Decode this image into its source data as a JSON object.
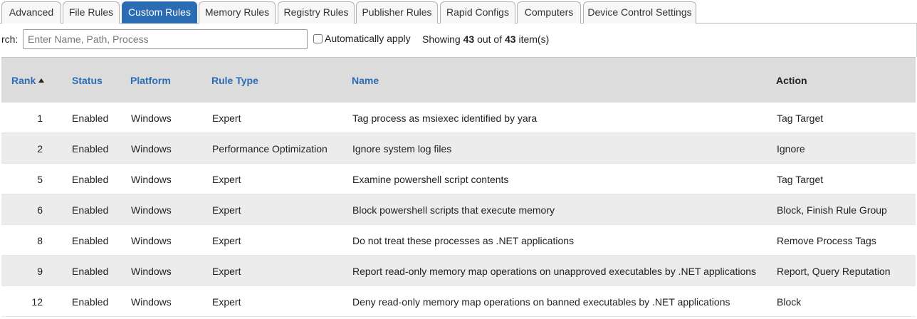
{
  "tabs": [
    {
      "label": "Advanced",
      "active": false
    },
    {
      "label": "File Rules",
      "active": false
    },
    {
      "label": "Custom Rules",
      "active": true
    },
    {
      "label": "Memory Rules",
      "active": false
    },
    {
      "label": "Registry Rules",
      "active": false
    },
    {
      "label": "Publisher Rules",
      "active": false
    },
    {
      "label": "Rapid Configs",
      "active": false
    },
    {
      "label": "Computers",
      "active": false
    },
    {
      "label": "Device Control Settings",
      "active": false
    }
  ],
  "toolbar": {
    "search_label": "rch:",
    "search_placeholder": "Enter Name, Path, Process",
    "search_value": "",
    "auto_apply_label": "Automatically apply",
    "auto_apply_checked": false,
    "showing_prefix": "Showing",
    "showing_count": "43",
    "showing_mid": "out of",
    "showing_total": "43",
    "showing_suffix": "item(s)"
  },
  "table": {
    "headers": {
      "rank": "Rank",
      "status": "Status",
      "platform": "Platform",
      "rule_type": "Rule Type",
      "name": "Name",
      "action": "Action"
    },
    "sort": {
      "column": "rank",
      "direction": "ascending",
      "icon": "sort-ascending-icon"
    },
    "rows": [
      {
        "rank": "1",
        "status": "Enabled",
        "platform": "Windows",
        "rule_type": "Expert",
        "name": "Tag process as msiexec identified by yara",
        "action": "Tag Target"
      },
      {
        "rank": "2",
        "status": "Enabled",
        "platform": "Windows",
        "rule_type": "Performance Optimization",
        "name": "Ignore system log files",
        "action": "Ignore"
      },
      {
        "rank": "5",
        "status": "Enabled",
        "platform": "Windows",
        "rule_type": "Expert",
        "name": "Examine powershell script contents",
        "action": "Tag Target"
      },
      {
        "rank": "6",
        "status": "Enabled",
        "platform": "Windows",
        "rule_type": "Expert",
        "name": "Block powershell scripts that execute memory",
        "action": "Block, Finish Rule Group"
      },
      {
        "rank": "8",
        "status": "Enabled",
        "platform": "Windows",
        "rule_type": "Expert",
        "name": "Do not treat these processes as .NET applications",
        "action": "Remove Process Tags"
      },
      {
        "rank": "9",
        "status": "Enabled",
        "platform": "Windows",
        "rule_type": "Expert",
        "name": "Report read-only memory map operations on unapproved executables by .NET applications",
        "action": "Report, Query Reputation"
      },
      {
        "rank": "12",
        "status": "Enabled",
        "platform": "Windows",
        "rule_type": "Expert",
        "name": "Deny read-only memory map operations on banned executables by .NET applications",
        "action": "Block"
      }
    ]
  },
  "colors": {
    "accent": "#2a6db5",
    "header_bg": "#dcdcdc",
    "row_alt_bg": "#ececec"
  }
}
